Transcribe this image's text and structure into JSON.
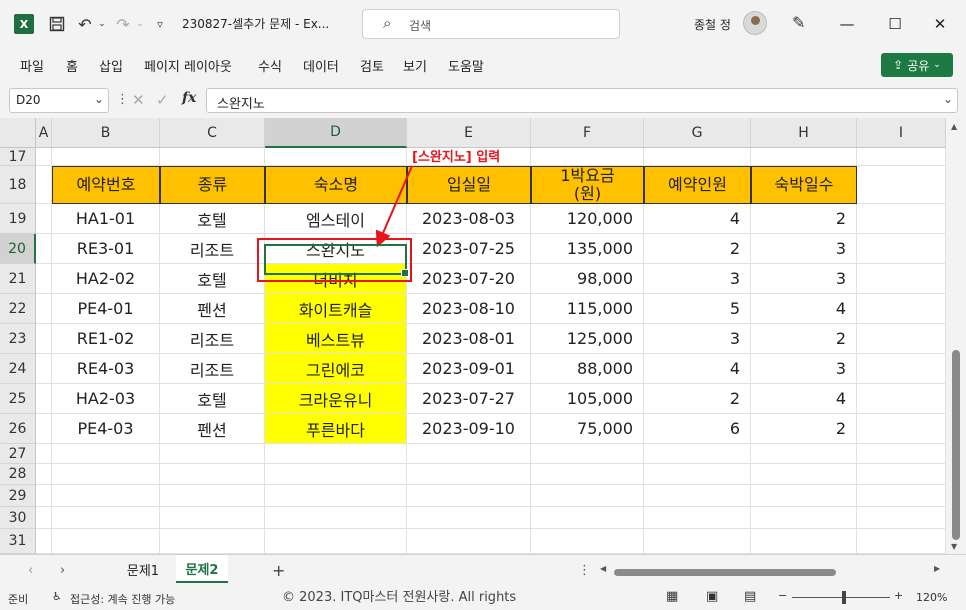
{
  "title_bar": {
    "app_icon": "X",
    "file_name": "230827-셀추가 문제  -  Ex...",
    "search_placeholder": "검색",
    "user_name": "종철 정",
    "quick_access": [
      "save-icon",
      "undo-icon",
      "redo-icon",
      "customize-icon"
    ],
    "window_controls": {
      "minimize": "—",
      "maximize": "☐",
      "close": "✕"
    }
  },
  "ribbon": {
    "tabs": [
      "파일",
      "홈",
      "삽입",
      "페이지 레이아웃",
      "수식",
      "데이터",
      "검토",
      "보기",
      "도움말"
    ],
    "share_label": "공유"
  },
  "formula_bar": {
    "name_box": "D20",
    "fx_label": "fx",
    "formula": "스완지노"
  },
  "columns": [
    "A",
    "B",
    "C",
    "D",
    "E",
    "F",
    "G",
    "H",
    "I"
  ],
  "selected_column": "D",
  "rows": [
    "17",
    "18",
    "19",
    "20",
    "21",
    "22",
    "23",
    "24",
    "25",
    "26",
    "27",
    "28",
    "29",
    "30",
    "31"
  ],
  "selected_row": "20",
  "table": {
    "headers": [
      "예약번호",
      "종류",
      "숙소명",
      "입실일",
      "1박요금\n(원)",
      "예약인원",
      "숙박일수"
    ],
    "rows": [
      [
        "HA1-01",
        "호텔",
        "엠스테이",
        "2023-08-03",
        "120,000",
        "4",
        "2"
      ],
      [
        "RE3-01",
        "리조트",
        "스완지노",
        "2023-07-25",
        "135,000",
        "2",
        "3"
      ],
      [
        "HA2-02",
        "호텔",
        "더비치",
        "2023-07-20",
        "98,000",
        "3",
        "3"
      ],
      [
        "PE4-01",
        "펜션",
        "화이트캐슬",
        "2023-08-10",
        "115,000",
        "5",
        "4"
      ],
      [
        "RE1-02",
        "리조트",
        "베스트뷰",
        "2023-08-01",
        "125,000",
        "3",
        "2"
      ],
      [
        "RE4-03",
        "리조트",
        "그린에코",
        "2023-09-01",
        "88,000",
        "4",
        "3"
      ],
      [
        "HA2-03",
        "호텔",
        "크라운유니",
        "2023-07-27",
        "105,000",
        "2",
        "4"
      ],
      [
        "PE4-03",
        "펜션",
        "푸른바다",
        "2023-09-10",
        "75,000",
        "6",
        "2"
      ]
    ]
  },
  "annotation": {
    "text": "[스완지노] 입력",
    "color": "#e8141b"
  },
  "sheet_tabs": {
    "tabs": [
      "문제1",
      "문제2"
    ],
    "active": "문제2",
    "add": "+"
  },
  "status_bar": {
    "ready": "준비",
    "accessibility": "접근성: 계속 진행 가능",
    "watermark": "© 2023. ITQ마스터 전원사랑. All rights",
    "zoom": "120%"
  },
  "colors": {
    "header_fill": "#ffc000",
    "highlight_fill": "#ffff00",
    "accent": "#217346",
    "share": "#1e7a43"
  }
}
